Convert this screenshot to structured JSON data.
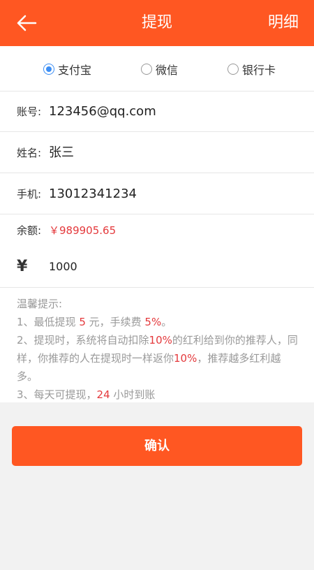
{
  "header": {
    "title": "提现",
    "detail_label": "明细"
  },
  "payment_methods": {
    "options": [
      {
        "label": "支付宝",
        "selected": true
      },
      {
        "label": "微信",
        "selected": false
      },
      {
        "label": "银行卡",
        "selected": false
      }
    ]
  },
  "form": {
    "account": {
      "label": "账号:",
      "value": "123456@qq.com"
    },
    "name": {
      "label": "姓名:",
      "value": "张三"
    },
    "phone": {
      "label": "手机:",
      "value": "13012341234"
    }
  },
  "balance": {
    "label": "余额:",
    "value": "￥989905.65"
  },
  "amount": {
    "currency_symbol": "¥",
    "value": "1000"
  },
  "tips": {
    "title": "温馨提示:",
    "line1": {
      "a": "1、最低提现 ",
      "min": "5",
      "b": " 元，手续费 ",
      "fee": "5%",
      "c": "。"
    },
    "line2": {
      "a": "2、提现时，系统将自动扣除",
      "pct1": "10%",
      "b": "的红利给到你的推荐人，同样，你推荐的人在提现时一样返你",
      "pct2": "10%",
      "c": "，推荐越多红利越多。"
    },
    "line3": {
      "a": "3、每天可提现，",
      "hours": "24",
      "b": " 小时到账"
    }
  },
  "confirm_label": "确认",
  "colors": {
    "primary": "#ff5722",
    "highlight": "#e4393c",
    "radio_checked": "#3d8ff5"
  }
}
